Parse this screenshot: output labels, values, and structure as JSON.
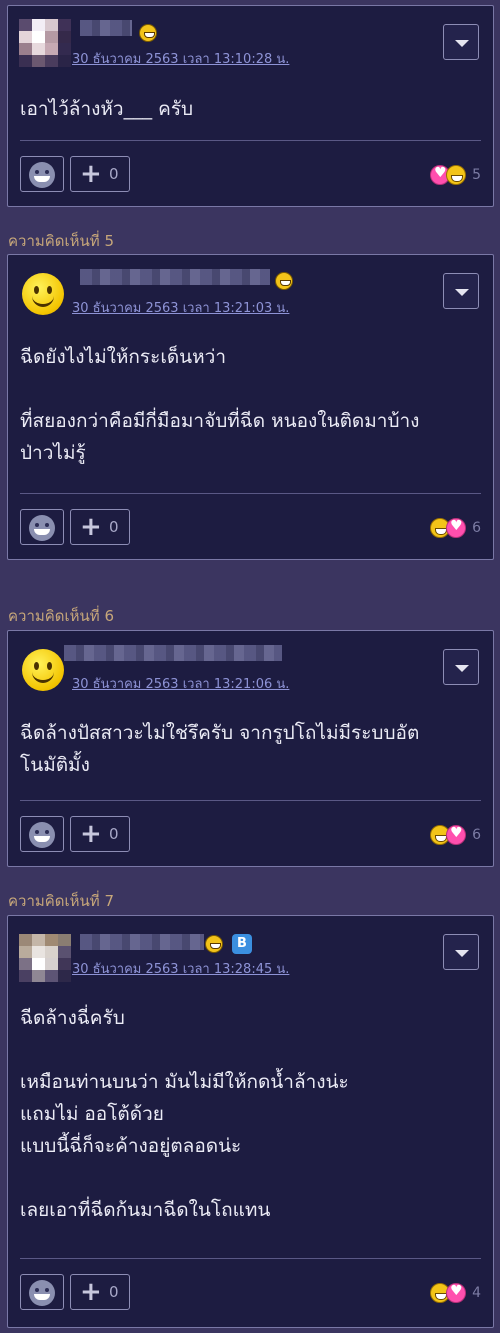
{
  "comments": [
    {
      "label": "",
      "timestamp": "30 ธันวาคม 2563 เวลา 13:10:28 น.",
      "lines": [
        "เอาไว้ล้างหัว___ ครับ"
      ],
      "plus_count": "0",
      "reaction_count": "5"
    },
    {
      "label": "ความคิดเห็นที่ 5",
      "timestamp": "30 ธันวาคม 2563 เวลา 13:21:03 น.",
      "lines": [
        "ฉีดยังไงไม่ให้กระเด็นหว่า",
        "",
        "ที่สยองกว่าคือมีกี่มือมาจับที่ฉีด หนองในติดมาบ้าง",
        "ป่าวไม่รู้"
      ],
      "plus_count": "0",
      "reaction_count": "6"
    },
    {
      "label": "ความคิดเห็นที่ 6",
      "timestamp": "30 ธันวาคม 2563 เวลา 13:21:06 น.",
      "lines": [
        "ฉีดล้างปัสสาวะไม่ใช่รึครับ จากรูปโถไม่มีระบบอัต",
        "โนมัติมั้ง"
      ],
      "plus_count": "0",
      "reaction_count": "6"
    },
    {
      "label": "ความคิดเห็นที่ 7",
      "timestamp": "30 ธันวาคม 2563 เวลา 13:28:45 น.",
      "lines": [
        "ฉีดล้างฉี่ครับ",
        "",
        "เหมือนท่านบนว่า มันไม่มีให้กดน้ำล้างน่ะ",
        "แถมไม่ ออโต้ด้วย",
        "แบบนี้ฉี่ก็จะค้างอยู่ตลอดน่ะ",
        "",
        "เลยเอาที่ฉีดก้นมาฉีดในโถแทน"
      ],
      "plus_count": "0",
      "reaction_count": "4"
    }
  ],
  "b_badge": "B",
  "icons": {
    "menu": "chevron-down-icon",
    "emotion": "smiley-icon",
    "plus": "plus-icon",
    "heart": "heart-reaction-icon",
    "laugh": "laugh-reaction-icon"
  }
}
